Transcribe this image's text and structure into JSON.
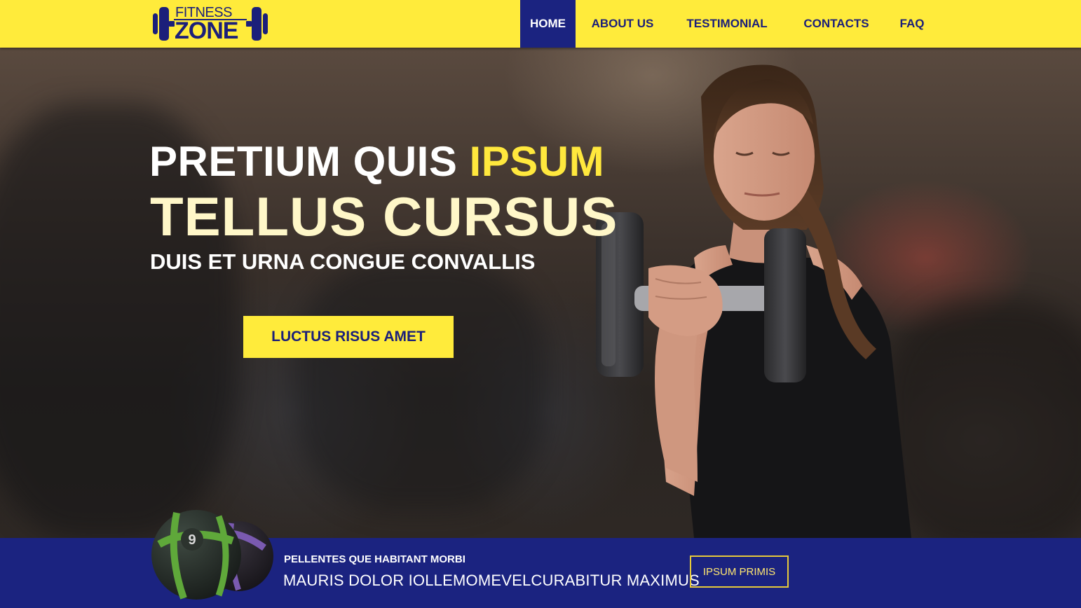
{
  "brand": {
    "line1": "FITNESS",
    "line2": "ZONE"
  },
  "nav": {
    "items": [
      {
        "label": "HOME",
        "active": true
      },
      {
        "label": "ABOUT US",
        "active": false
      },
      {
        "label": "TESTIMONIAL",
        "active": false
      },
      {
        "label": "CONTACTS",
        "active": false
      },
      {
        "label": "FAQ",
        "active": false
      }
    ]
  },
  "hero": {
    "title_part1": "PRETIUM QUIS ",
    "title_highlight": "IPSUM",
    "title_line2": "TELLUS CURSUS",
    "subtitle": "DUIS ET URNA CONGUE CONVALLIS",
    "cta_label": "LUCTUS RISUS AMET"
  },
  "band": {
    "kicker": "PELLENTES QUE HABITANT MORBI",
    "text": "MAURIS DOLOR IOLLEMOMEVELCURABITUR MAXIMUS",
    "button_label": "IPSUM PRIMIS",
    "ball_number": "9"
  },
  "colors": {
    "accent_yellow": "#ffeb3b",
    "brand_navy": "#1b2380",
    "highlight": "#ffe83d"
  }
}
